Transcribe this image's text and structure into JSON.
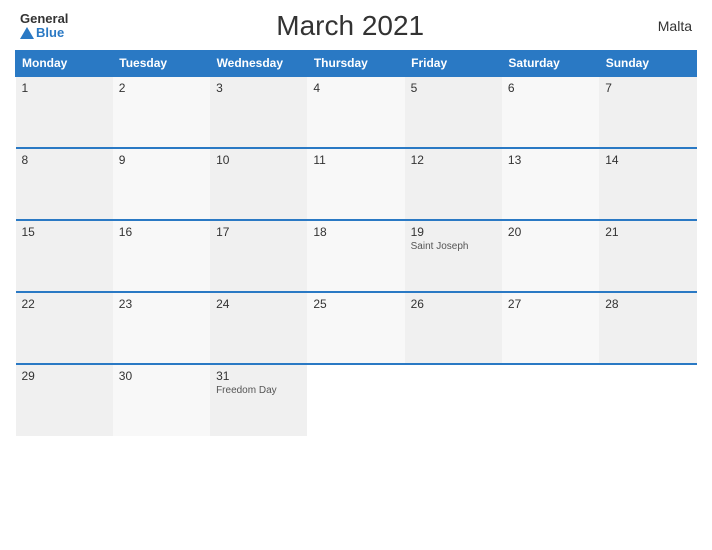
{
  "header": {
    "logo_general": "General",
    "logo_blue": "Blue",
    "title": "March 2021",
    "country": "Malta"
  },
  "columns": [
    "Monday",
    "Tuesday",
    "Wednesday",
    "Thursday",
    "Friday",
    "Saturday",
    "Sunday"
  ],
  "weeks": [
    [
      {
        "day": "1",
        "holiday": ""
      },
      {
        "day": "2",
        "holiday": ""
      },
      {
        "day": "3",
        "holiday": ""
      },
      {
        "day": "4",
        "holiday": ""
      },
      {
        "day": "5",
        "holiday": ""
      },
      {
        "day": "6",
        "holiday": ""
      },
      {
        "day": "7",
        "holiday": ""
      }
    ],
    [
      {
        "day": "8",
        "holiday": ""
      },
      {
        "day": "9",
        "holiday": ""
      },
      {
        "day": "10",
        "holiday": ""
      },
      {
        "day": "11",
        "holiday": ""
      },
      {
        "day": "12",
        "holiday": ""
      },
      {
        "day": "13",
        "holiday": ""
      },
      {
        "day": "14",
        "holiday": ""
      }
    ],
    [
      {
        "day": "15",
        "holiday": ""
      },
      {
        "day": "16",
        "holiday": ""
      },
      {
        "day": "17",
        "holiday": ""
      },
      {
        "day": "18",
        "holiday": ""
      },
      {
        "day": "19",
        "holiday": "Saint Joseph"
      },
      {
        "day": "20",
        "holiday": ""
      },
      {
        "day": "21",
        "holiday": ""
      }
    ],
    [
      {
        "day": "22",
        "holiday": ""
      },
      {
        "day": "23",
        "holiday": ""
      },
      {
        "day": "24",
        "holiday": ""
      },
      {
        "day": "25",
        "holiday": ""
      },
      {
        "day": "26",
        "holiday": ""
      },
      {
        "day": "27",
        "holiday": ""
      },
      {
        "day": "28",
        "holiday": ""
      }
    ],
    [
      {
        "day": "29",
        "holiday": ""
      },
      {
        "day": "30",
        "holiday": ""
      },
      {
        "day": "31",
        "holiday": "Freedom Day"
      },
      {
        "day": "",
        "holiday": ""
      },
      {
        "day": "",
        "holiday": ""
      },
      {
        "day": "",
        "holiday": ""
      },
      {
        "day": "",
        "holiday": ""
      }
    ]
  ]
}
